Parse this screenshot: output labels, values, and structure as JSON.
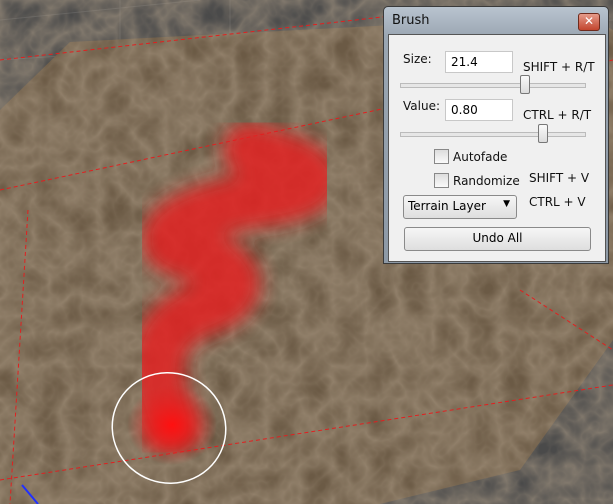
{
  "brush_panel": {
    "title": "Brush",
    "close_glyph": "✕",
    "size_label": "Size:",
    "size_value": "21.4",
    "size_shortcut": "SHIFT + R/T",
    "size_slider_fraction": 0.7,
    "value_label": "Value:",
    "value_value": "0.80",
    "value_shortcut": "CTRL + R/T",
    "value_slider_fraction": 0.8,
    "autofade_label": "Autofade",
    "autofade_checked": false,
    "randomize_label": "Randomize",
    "randomize_checked": false,
    "randomize_shortcut": "SHIFT + V",
    "layer_select": "Terrain Layer",
    "layer_shortcut": "CTRL + V",
    "undo_all": "Undo All"
  },
  "colors": {
    "paint": "#e32020",
    "terrain": "#6b5a45",
    "grid_red": "#e02020"
  }
}
